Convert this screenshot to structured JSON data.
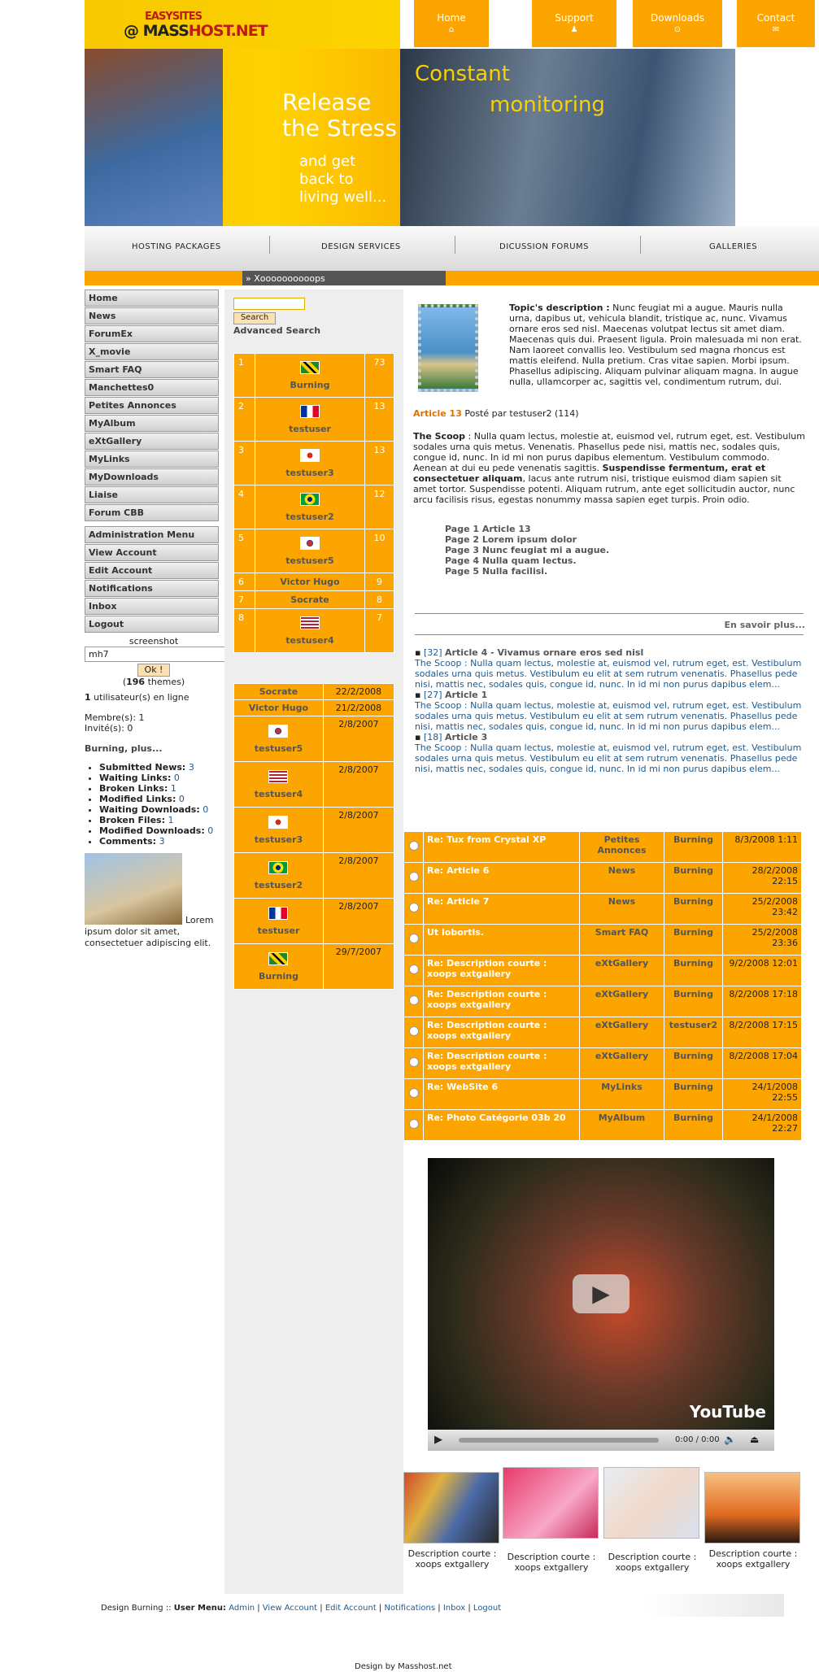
{
  "header": {
    "logo_top": "EASYSITES",
    "logo_main_prefix": "@ ",
    "logo_main_a": "MASS",
    "logo_main_b": "HOST.NET",
    "nav": [
      {
        "label": "Home",
        "icon": "home-icon"
      },
      {
        "label": "Support",
        "icon": "support-icon"
      },
      {
        "label": "Downloads",
        "icon": "download-icon"
      },
      {
        "label": "Contact",
        "icon": "mail-icon"
      }
    ],
    "hero_left_line1": "Release",
    "hero_left_line2": "the Stress",
    "hero_left_line3": "and get",
    "hero_left_line4": "back to",
    "hero_left_line5": "living well...",
    "hero_right_line1": "Constant",
    "hero_right_line2": "monitoring",
    "mainnav": [
      "HOSTING PACKAGES",
      "DESIGN SERVICES",
      "DICUSSION FORUMS",
      "GALLERIES"
    ],
    "ticker": "Xoooooooooops"
  },
  "left": {
    "menu": [
      "Home",
      "News",
      "ForumEx",
      "X_movie",
      "Smart FAQ",
      "Manchettes0",
      "Petites Annonces",
      "MyAlbum",
      "eXtGallery",
      "MyLinks",
      "MyDownloads",
      "Liaise",
      "Forum CBB"
    ],
    "user_menu": [
      "Administration Menu",
      "View Account",
      "Edit Account",
      "Notifications",
      "Inbox",
      "Logout"
    ],
    "screenshot_label": "screenshot",
    "theme_value": "mh7",
    "ok_label": "Ok !",
    "themes_count": "196",
    "themes_text": " themes)",
    "online_count": "1",
    "online_text": " utilisateur(s) en ligne",
    "members": "Membre(s): 1",
    "guests": "Invité(s): 0",
    "burning_title": "Burning, plus...",
    "stats": [
      {
        "label": "Submitted News:",
        "val": "3"
      },
      {
        "label": "Waiting Links:",
        "val": "0"
      },
      {
        "label": "Broken Links:",
        "val": "1"
      },
      {
        "label": "Modified Links:",
        "val": "0"
      },
      {
        "label": "Waiting Downloads:",
        "val": "0"
      },
      {
        "label": "Broken Files:",
        "val": "1"
      },
      {
        "label": "Modified Downloads:",
        "val": "0"
      },
      {
        "label": "Comments:",
        "val": "3"
      }
    ],
    "camel_text": "Lorem ipsum dolor sit amet, consectetuer adipiscing elit."
  },
  "center": {
    "search_button": "Search",
    "advanced_search": "Advanced Search",
    "ranking": [
      {
        "n": "1",
        "name": "Burning",
        "score": "73",
        "flag": "jamaica"
      },
      {
        "n": "2",
        "name": "testuser",
        "score": "13",
        "flag": "france"
      },
      {
        "n": "3",
        "name": "testuser3",
        "score": "13",
        "flag": "canada"
      },
      {
        "n": "4",
        "name": "testuser2",
        "score": "12",
        "flag": "brazil"
      },
      {
        "n": "5",
        "name": "testuser5",
        "score": "10",
        "flag": "korea"
      },
      {
        "n": "6",
        "name": "Victor Hugo",
        "score": "9",
        "flag": ""
      },
      {
        "n": "7",
        "name": "Socrate",
        "score": "8",
        "flag": ""
      },
      {
        "n": "8",
        "name": "testuser4",
        "score": "7",
        "flag": "usa"
      }
    ],
    "latest": [
      {
        "name": "Socrate",
        "date": "22/2/2008",
        "flag": ""
      },
      {
        "name": "Victor Hugo",
        "date": "21/2/2008",
        "flag": ""
      },
      {
        "name": "testuser5",
        "date": "2/8/2007",
        "flag": "korea"
      },
      {
        "name": "testuser4",
        "date": "2/8/2007",
        "flag": "usa"
      },
      {
        "name": "testuser3",
        "date": "2/8/2007",
        "flag": "canada"
      },
      {
        "name": "testuser2",
        "date": "2/8/2007",
        "flag": "brazil"
      },
      {
        "name": "testuser",
        "date": "2/8/2007",
        "flag": "france"
      },
      {
        "name": "Burning",
        "date": "29/7/2007",
        "flag": "jamaica"
      }
    ]
  },
  "right": {
    "topic_label": "Topic's description :",
    "topic_text": " Nunc feugiat mi a augue. Mauris nulla urna, dapibus ut, vehicula blandit, tristique ac, nunc. Vivamus ornare eros sed nisl. Maecenas volutpat lectus sit amet diam. Maecenas quis dui. Praesent ligula. Proin malesuada mi non erat. Nam laoreet convallis leo. Vestibulum sed magna rhoncus est mattis eleifend. Nulla pretium. Cras vitae sapien. Morbi ipsum. Phasellus adipiscing. Aliquam pulvinar aliquam magna. In augue nulla, ullamcorper ac, sagittis vel, condimentum rutrum, dui.",
    "article_label": "Article 13",
    "article_meta": " Posté par testuser2 (114)",
    "scoop_label": "The Scoop",
    "scoop_text1": " : Nulla quam lectus, molestie at, euismod vel, rutrum eget, est. Vestibulum sodales urna quis metus. Venenatis. Phasellus pede nisi, mattis nec, sodales quis, congue id, nunc. In id mi non purus dapibus elementum. Vestibulum commodo. Aenean at dui eu pede venenatis sagittis. ",
    "scoop_bold": "Suspendisse fermentum, erat et consectetuer aliquam",
    "scoop_text2": ", lacus ante rutrum nisi, tristique euismod diam sapien sit amet tortor. Suspendisse potenti. Aliquam rutrum, ante eget sollicitudin auctor, nunc arcu facilisis risus, egestas nonummy massa sapien eget turpis. Proin odio.",
    "pages": [
      "Page 1 Article 13",
      "Page 2 Lorem ipsum dolor",
      "Page 3 Nunc feugiat mi a augue.",
      "Page 4 Nulla quam lectus.",
      "Page 5 Nulla facilisi."
    ],
    "read_more": "En savoir plus...",
    "related": [
      {
        "id": "[32]",
        "title": "Article 4 - Vivamus ornare eros sed nisl",
        "text": "The Scoop : Nulla quam lectus, molestie at, euismod vel, rutrum eget, est. Vestibulum sodales urna quis metus. Vestibulum eu elit at sem rutrum venenatis. Phasellus pede nisi, mattis nec, sodales quis, congue id, nunc. In id mi non purus dapibus elem..."
      },
      {
        "id": "[27]",
        "title": "Article 1",
        "text": "The Scoop : Nulla quam lectus, molestie at, euismod vel, rutrum eget, est. Vestibulum sodales urna quis metus. Vestibulum eu elit at sem rutrum venenatis. Phasellus pede nisi, mattis nec, sodales quis, congue id, nunc. In id mi non purus dapibus elem..."
      },
      {
        "id": "[18]",
        "title": "Article 3",
        "text": "The Scoop : Nulla quam lectus, molestie at, euismod vel, rutrum eget, est. Vestibulum sodales urna quis metus. Vestibulum eu elit at sem rutrum venenatis. Phasellus pede nisi, mattis nec, sodales quis, congue id, nunc. In id mi non purus dapibus elem..."
      }
    ],
    "forum": [
      {
        "title": "Re: Tux from Crystal XP",
        "forum": "Petites Annonces",
        "poster": "Burning",
        "date": "8/3/2008 1:11"
      },
      {
        "title": "Re: Article 6",
        "forum": "News",
        "poster": "Burning",
        "date": "28/2/2008 22:15"
      },
      {
        "title": "Re: Article 7",
        "forum": "News",
        "poster": "Burning",
        "date": "25/2/2008 23:42"
      },
      {
        "title": "Ut lobortis.",
        "forum": "Smart FAQ",
        "poster": "Burning",
        "date": "25/2/2008 23:36"
      },
      {
        "title": "Re: Description courte : xoops extgallery",
        "forum": "eXtGallery",
        "poster": "Burning",
        "date": "9/2/2008 12:01"
      },
      {
        "title": "Re: Description courte : xoops extgallery",
        "forum": "eXtGallery",
        "poster": "Burning",
        "date": "8/2/2008 17:18"
      },
      {
        "title": "Re: Description courte : xoops extgallery",
        "forum": "eXtGallery",
        "poster": "testuser2",
        "date": "8/2/2008 17:15"
      },
      {
        "title": "Re: Description courte : xoops extgallery",
        "forum": "eXtGallery",
        "poster": "Burning",
        "date": "8/2/2008 17:04"
      },
      {
        "title": "Re: WebSite 6",
        "forum": "MyLinks",
        "poster": "Burning",
        "date": "24/1/2008 22:55"
      },
      {
        "title": "Re: Photo Catégorie 03b 20",
        "forum": "MyAlbum",
        "poster": "Burning",
        "date": "24/1/2008 22:27"
      }
    ],
    "video_time": "0:00 / 0:00",
    "video_brand": "YouTube",
    "gallery_captions": [
      "Description courte : xoops extgallery",
      "Description courte : xoops extgallery",
      "Description courte : xoops extgallery",
      "Description courte : xoops extgallery"
    ]
  },
  "footer": {
    "design_label": "Design Burning :: ",
    "user_menu_label": "User Menu:",
    "links": [
      "Admin",
      "View Account",
      "Edit Account",
      "Notifications",
      "Inbox",
      "Logout"
    ],
    "credit": "Design by Masshost.net"
  }
}
